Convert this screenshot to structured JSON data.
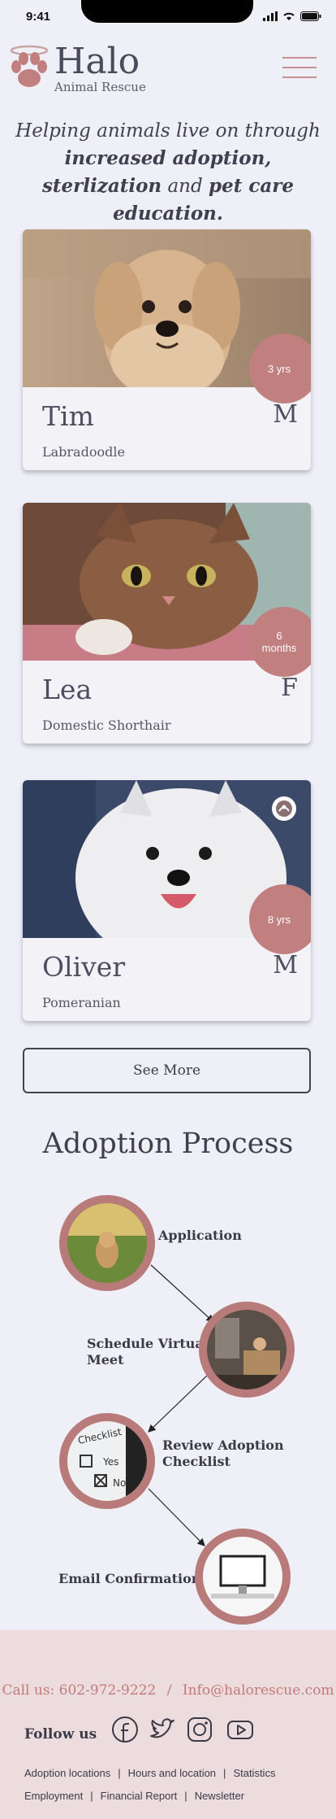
{
  "status": {
    "time": "9:41"
  },
  "header": {
    "brand": "Halo",
    "subtitle": "Animal Rescue"
  },
  "tagline": {
    "line1": "Helping animals live on through",
    "line2": "increased adoption,",
    "line3a": "sterlization",
    "line3b": " and ",
    "line3c": "pet care education."
  },
  "pets": [
    {
      "name": "Tim",
      "sex": "M",
      "breed": "Labradoodle",
      "age": "3 yrs"
    },
    {
      "name": "Lea",
      "sex": "F",
      "breed": "Domestic Shorthair",
      "age_line1": "6",
      "age_line2": "months"
    },
    {
      "name": "Oliver",
      "sex": "M",
      "breed": "Pomeranian",
      "age": "8 yrs",
      "badge": "care-hands-icon"
    }
  ],
  "see_more": "See More",
  "adoption": {
    "title": "Adoption Process",
    "steps": [
      {
        "label": "Application",
        "icon": "dog-photo"
      },
      {
        "label_line1": "Schedule Virtual",
        "label_line2": "Meet",
        "icon": "video-meet-photo"
      },
      {
        "label_line1": "Review Adoption",
        "label_line2": "Checklist",
        "icon": "checklist-photo",
        "note_title": "Checklist",
        "note_yes": "Yes",
        "note_no": "No"
      },
      {
        "label": "Email Confirmation",
        "icon": "computer-photo"
      }
    ]
  },
  "footer": {
    "call_label": "Call us: 602-972-9222",
    "divider": "/",
    "email": "Info@halorescue.com",
    "follow": "Follow us",
    "social": [
      "facebook-icon",
      "twitter-icon",
      "instagram-icon",
      "youtube-icon"
    ],
    "links_row1": [
      "Adoption locations",
      "Hours and location",
      "Statistics"
    ],
    "links_row2": [
      "Employment",
      "Financial Report",
      "Newsletter"
    ]
  },
  "colors": {
    "accent": "#c17f7f",
    "background": "#efeff8",
    "footer": "#ecdcde"
  }
}
